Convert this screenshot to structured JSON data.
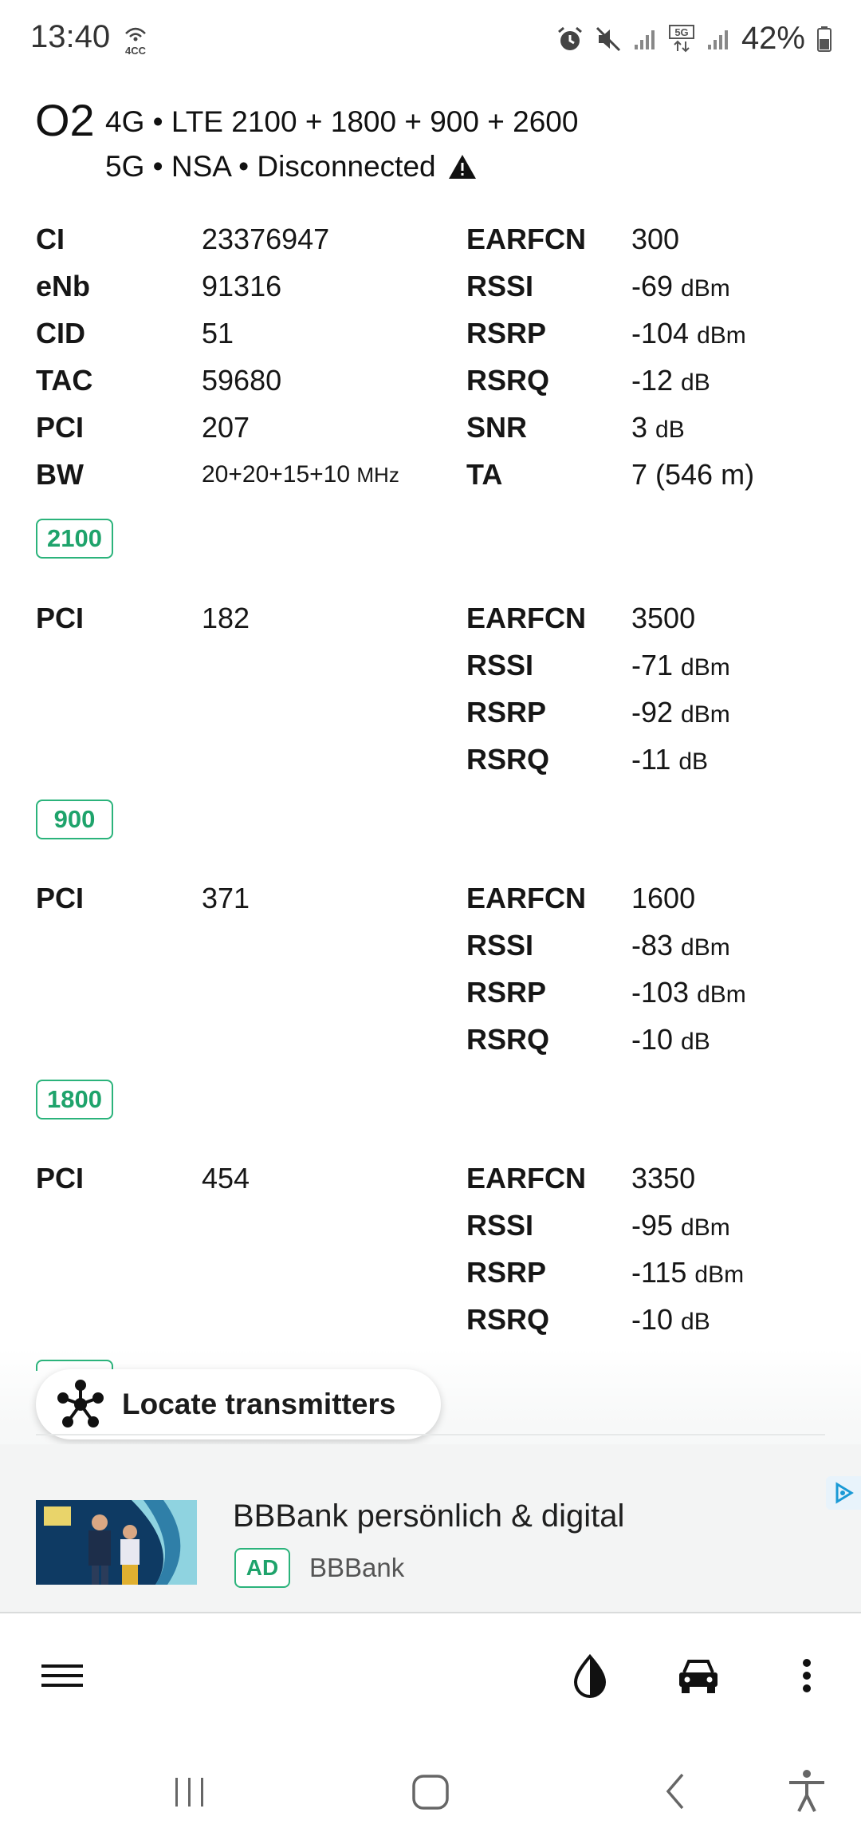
{
  "status_bar": {
    "time": "13:40",
    "network_badge": "4CC",
    "battery": "42%",
    "icons": [
      "alarm-icon",
      "mute-icon",
      "signal-icon",
      "5g-icon",
      "signal-icon",
      "battery-icon"
    ]
  },
  "header": {
    "operator": "O2",
    "line1": "4G • LTE 2100 + 1800 + 900 + 2600",
    "line2": "5G • NSA • Disconnected",
    "warning_icon": "warning-icon"
  },
  "primary_cell": {
    "left": [
      {
        "key": "CI",
        "value": "23376947"
      },
      {
        "key": "eNb",
        "value": "91316"
      },
      {
        "key": "CID",
        "value": "51"
      },
      {
        "key": "TAC",
        "value": "59680"
      },
      {
        "key": "PCI",
        "value": "207"
      },
      {
        "key": "BW",
        "value": "20+20+15+10",
        "unit": "MHz"
      }
    ],
    "right": [
      {
        "key": "EARFCN",
        "value": "300",
        "unit": ""
      },
      {
        "key": "RSSI",
        "value": "-69",
        "unit": "dBm"
      },
      {
        "key": "RSRP",
        "value": "-104",
        "unit": "dBm"
      },
      {
        "key": "RSRQ",
        "value": "-12",
        "unit": "dB"
      },
      {
        "key": "SNR",
        "value": "3",
        "unit": "dB"
      },
      {
        "key": "TA",
        "value": "7 (546 m)",
        "unit": ""
      }
    ],
    "band": "2100"
  },
  "secondary_cells": [
    {
      "pci_key": "PCI",
      "pci": "182",
      "right": [
        {
          "key": "EARFCN",
          "value": "3500",
          "unit": ""
        },
        {
          "key": "RSSI",
          "value": "-71",
          "unit": "dBm"
        },
        {
          "key": "RSRP",
          "value": "-92",
          "unit": "dBm"
        },
        {
          "key": "RSRQ",
          "value": "-11",
          "unit": "dB"
        }
      ],
      "band": "900"
    },
    {
      "pci_key": "PCI",
      "pci": "371",
      "right": [
        {
          "key": "EARFCN",
          "value": "1600",
          "unit": ""
        },
        {
          "key": "RSSI",
          "value": "-83",
          "unit": "dBm"
        },
        {
          "key": "RSRP",
          "value": "-103",
          "unit": "dBm"
        },
        {
          "key": "RSRQ",
          "value": "-10",
          "unit": "dB"
        }
      ],
      "band": "1800"
    },
    {
      "pci_key": "PCI",
      "pci": "454",
      "right": [
        {
          "key": "EARFCN",
          "value": "3350",
          "unit": ""
        },
        {
          "key": "RSSI",
          "value": "-95",
          "unit": "dBm"
        },
        {
          "key": "RSRP",
          "value": "-115",
          "unit": "dBm"
        },
        {
          "key": "RSRQ",
          "value": "-10",
          "unit": "dB"
        }
      ]
    }
  ],
  "locate_button": {
    "label": "Locate transmitters",
    "icon": "transmitter-network-icon"
  },
  "ad": {
    "title": "BBBank persönlich & digital",
    "badge": "AD",
    "sponsor": "BBBank",
    "choices_icon": "adchoices-icon"
  },
  "app_bar": {
    "icons": [
      "menu-icon",
      "theme-contrast-icon",
      "car-icon",
      "more-vert-icon"
    ]
  },
  "nav_bar": {
    "icons": [
      "recent-apps-icon",
      "home-icon",
      "back-icon",
      "accessibility-icon"
    ]
  },
  "colors": {
    "accent_green": "#2bb37b",
    "ad_background": "#f3f4f4",
    "text": "#161616"
  }
}
